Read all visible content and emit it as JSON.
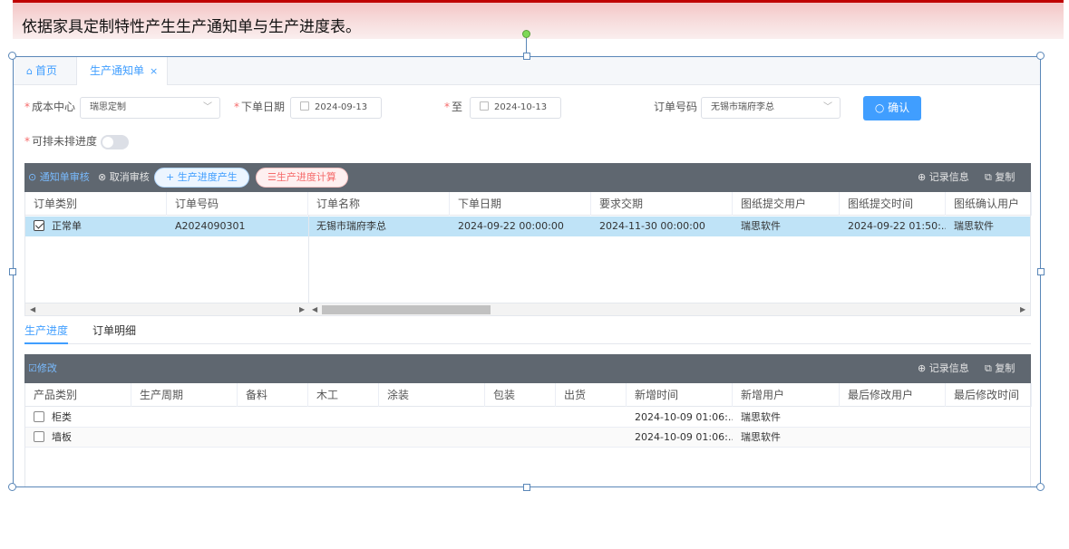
{
  "caption": "依据家具定制特性产生生产通知单与生产进度表。",
  "tabs": {
    "home": "首页",
    "active": "生产通知单",
    "close": "×"
  },
  "filters": {
    "cost_center_label": "成本中心",
    "cost_center_value": "瑞思定制",
    "order_date_label": "下单日期",
    "date_from": "2024-09-13",
    "to_label": "至",
    "date_to": "2024-10-13",
    "order_no_label": "订单号码",
    "order_no_value": "无锡市瑞府李总",
    "confirm": "确认",
    "schedulable_label": "可排未排进度",
    "required_mark": "*"
  },
  "toolbar1": {
    "approve": "通知单审核",
    "cancel": "取消审核",
    "produce": "生产进度产生",
    "calc": "生产进度计算",
    "record": "记录信息",
    "copy": "复制"
  },
  "grid1": {
    "columns": [
      "订单类别",
      "订单号码",
      "订单名称",
      "下单日期",
      "要求交期",
      "图纸提交用户",
      "图纸提交时间",
      "图纸确认用户"
    ],
    "rows": [
      [
        "正常单",
        "A2024090301",
        "无锡市瑞府李总",
        "2024-09-22 00:00:00",
        "2024-11-30 00:00:00",
        "瑞思软件",
        "2024-09-22 01:50:...",
        "瑞思软件"
      ]
    ]
  },
  "subtabs": [
    "生产进度",
    "订单明细"
  ],
  "toolbar2": {
    "edit": "修改",
    "record": "记录信息",
    "copy": "复制"
  },
  "grid2": {
    "columns": [
      "产品类别",
      "生产周期",
      "备料",
      "木工",
      "涂装",
      "包装",
      "出货",
      "新增时间",
      "新增用户",
      "最后修改用户",
      "最后修改时间"
    ],
    "rows": [
      [
        "柜类",
        "",
        "",
        "",
        "",
        "",
        "",
        "2024-10-09 01:06:...",
        "瑞思软件",
        "",
        ""
      ],
      [
        "墙板",
        "",
        "",
        "",
        "",
        "",
        "",
        "2024-10-09 01:06:...",
        "瑞思软件",
        "",
        ""
      ]
    ]
  },
  "colors": {
    "accent": "#409eff",
    "toolbar": "#5f6770",
    "selected_row": "#bfe3f7",
    "banner_red": "#c00000"
  }
}
